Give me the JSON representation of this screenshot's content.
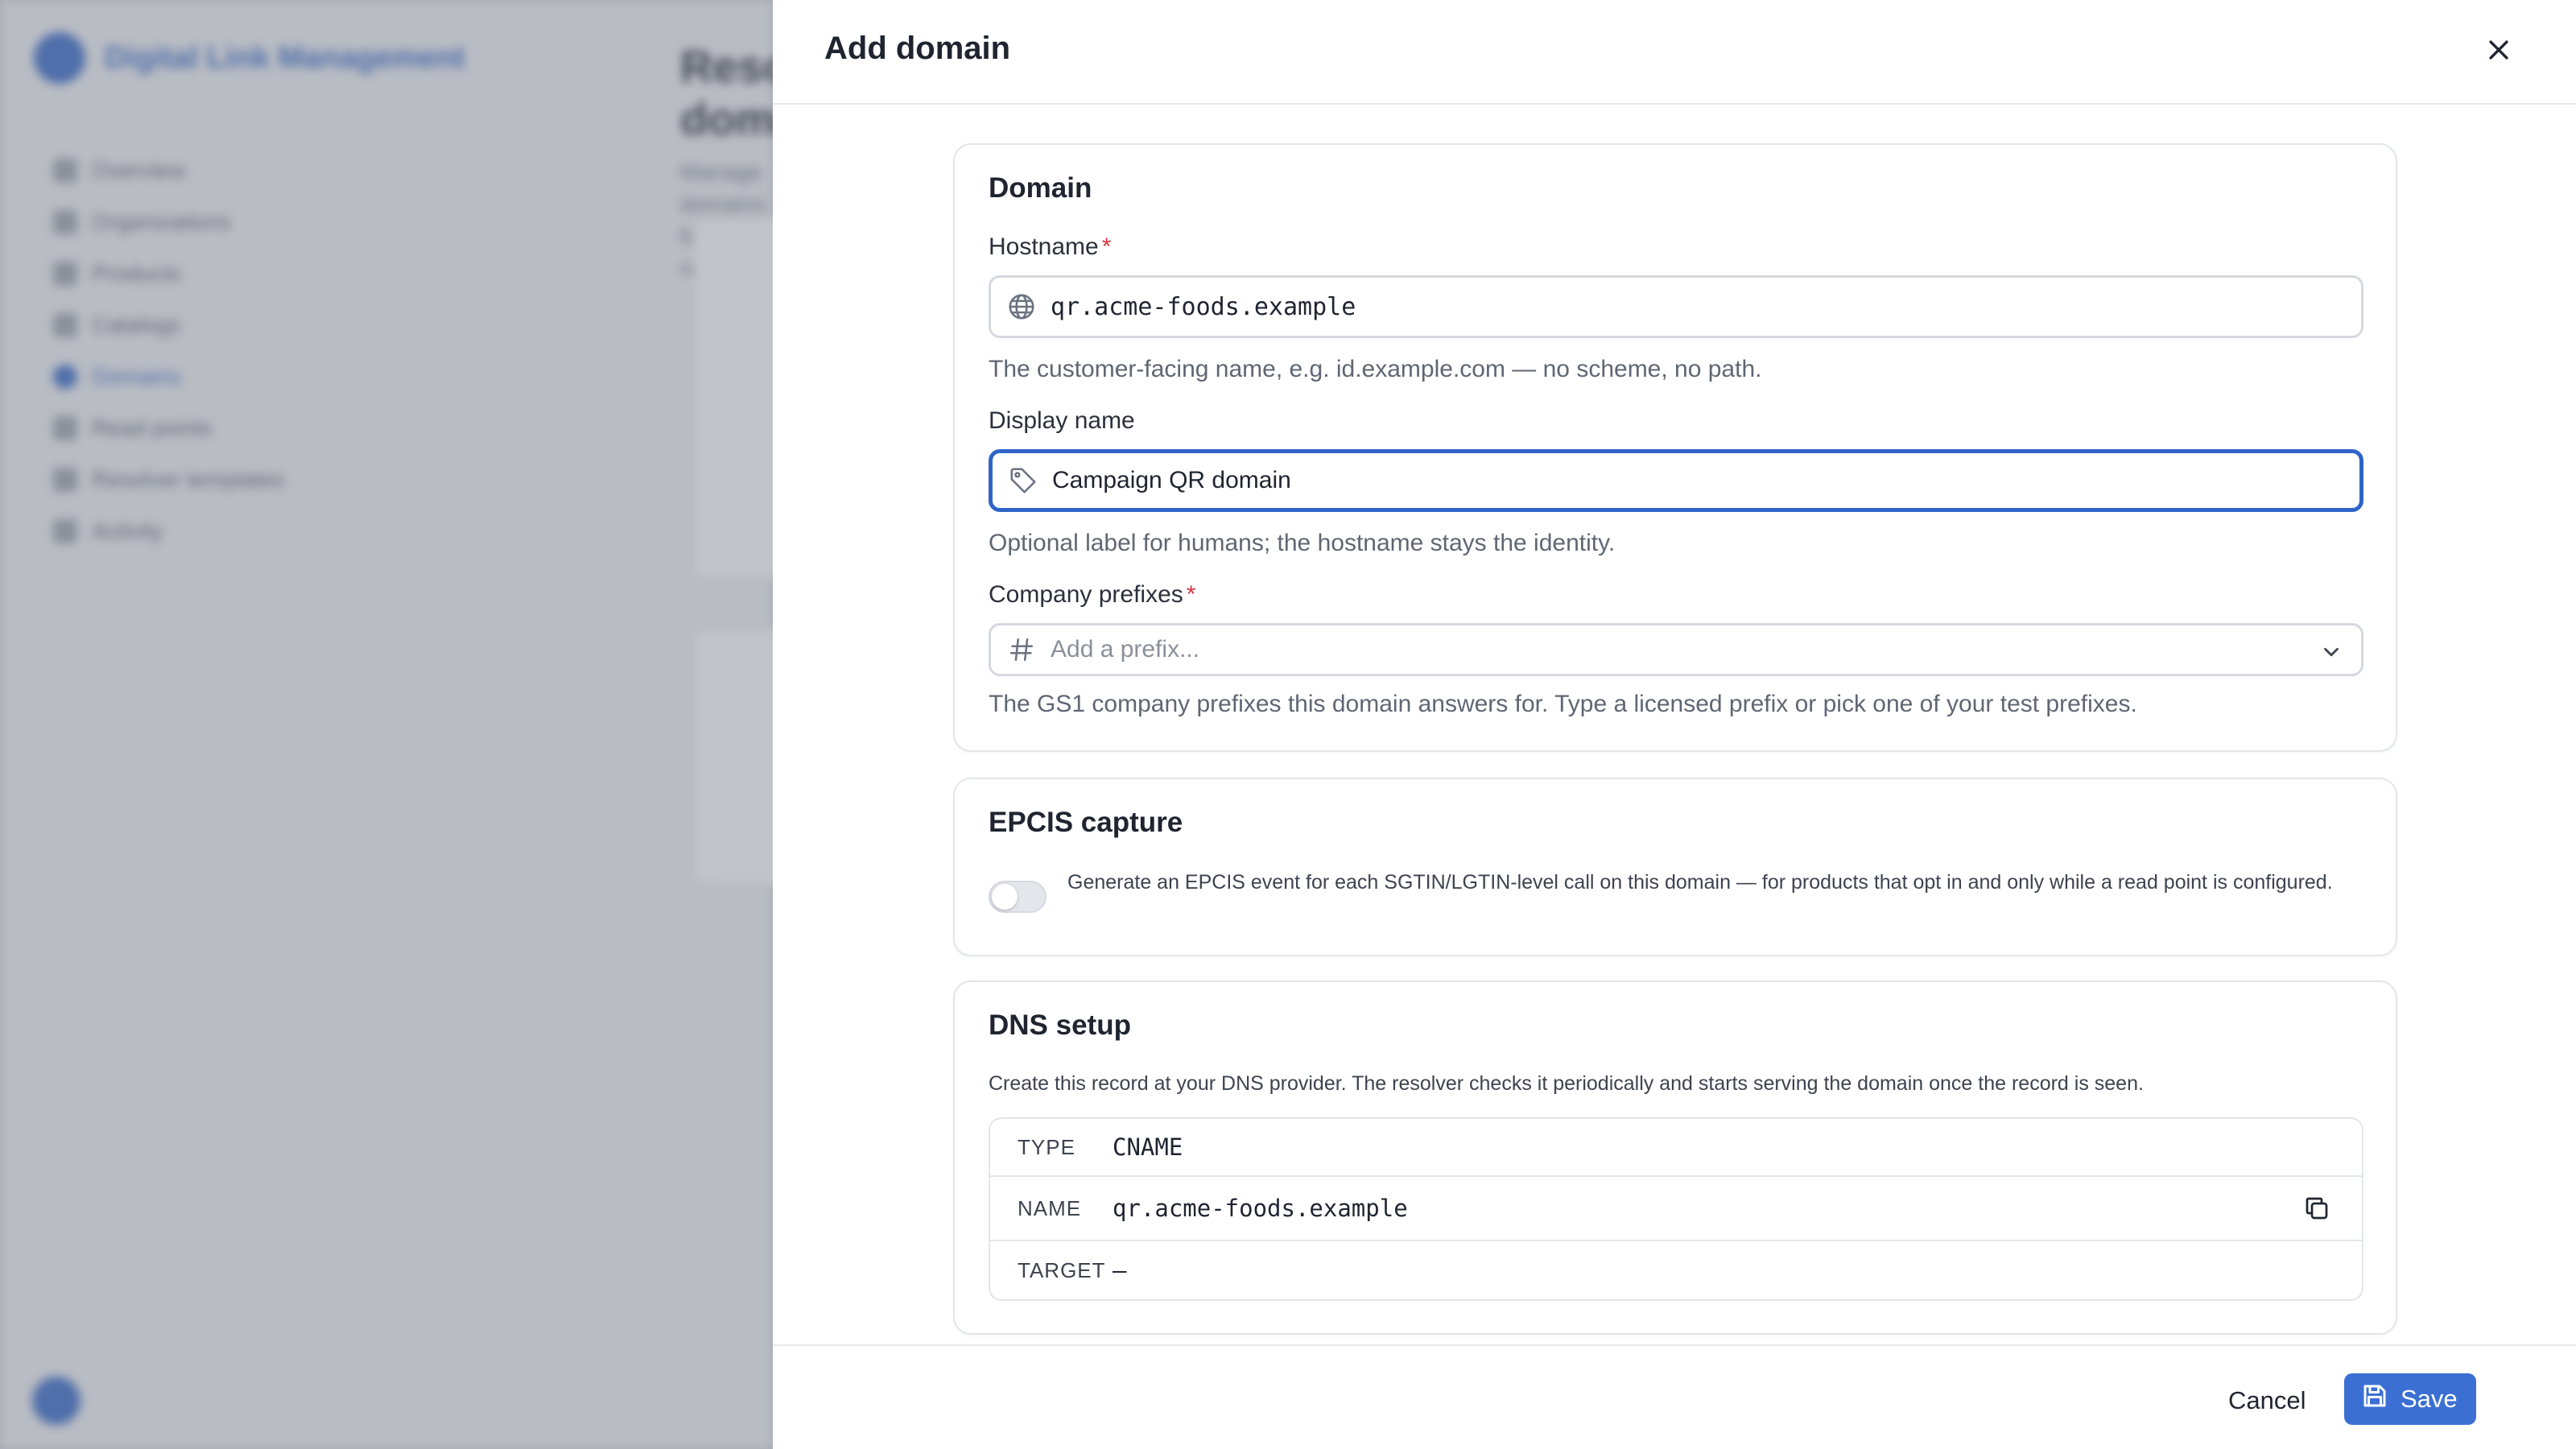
{
  "background": {
    "app_name": "Digital Link Management",
    "nav_items": [
      "Overview",
      "Organizations",
      "Products",
      "Catalogs",
      "Domains",
      "Read points",
      "Resolver templates",
      "Activity"
    ],
    "active_nav": "Domains",
    "page_title": "Resolver domains",
    "page_subtitle": "Manage domains for the resolver"
  },
  "drawer": {
    "title": "Add domain",
    "close_icon": "close-icon"
  },
  "domain_section": {
    "title": "Domain",
    "hostname": {
      "label": "Hostname",
      "required_mark": "*",
      "value": "qr.acme-foods.example",
      "icon": "globe-icon",
      "help": "The customer-facing name, e.g. id.example.com — no scheme, no path."
    },
    "display_name": {
      "label": "Display name",
      "value": "Campaign QR domain",
      "icon": "tag-icon",
      "help": "Optional label for humans; the hostname stays the identity."
    },
    "company_prefixes": {
      "label": "Company prefixes",
      "required_mark": "*",
      "placeholder": "Add a prefix...",
      "icon": "hash-icon",
      "help": "The GS1 company prefixes this domain answers for. Type a licensed prefix or pick one of your test prefixes."
    }
  },
  "epcis_section": {
    "title": "EPCIS capture",
    "toggle_on": false,
    "toggle_text": "Generate an EPCIS event for each SGTIN/LGTIN-level call on this domain — for products that opt in and only while a read point is configured."
  },
  "dns_section": {
    "title": "DNS setup",
    "description": "Create this record at your DNS provider. The resolver checks it periodically and starts serving the domain once the record is seen.",
    "rows": [
      {
        "key": "TYPE",
        "value": "CNAME"
      },
      {
        "key": "NAME",
        "value": "qr.acme-foods.example"
      },
      {
        "key": "TARGET",
        "value": "–"
      }
    ]
  },
  "footer": {
    "cancel_label": "Cancel",
    "save_label": "Save"
  },
  "colors": {
    "accent": "#2f64c8",
    "primary_button": "#3b6fd4",
    "required": "#d9363e"
  }
}
